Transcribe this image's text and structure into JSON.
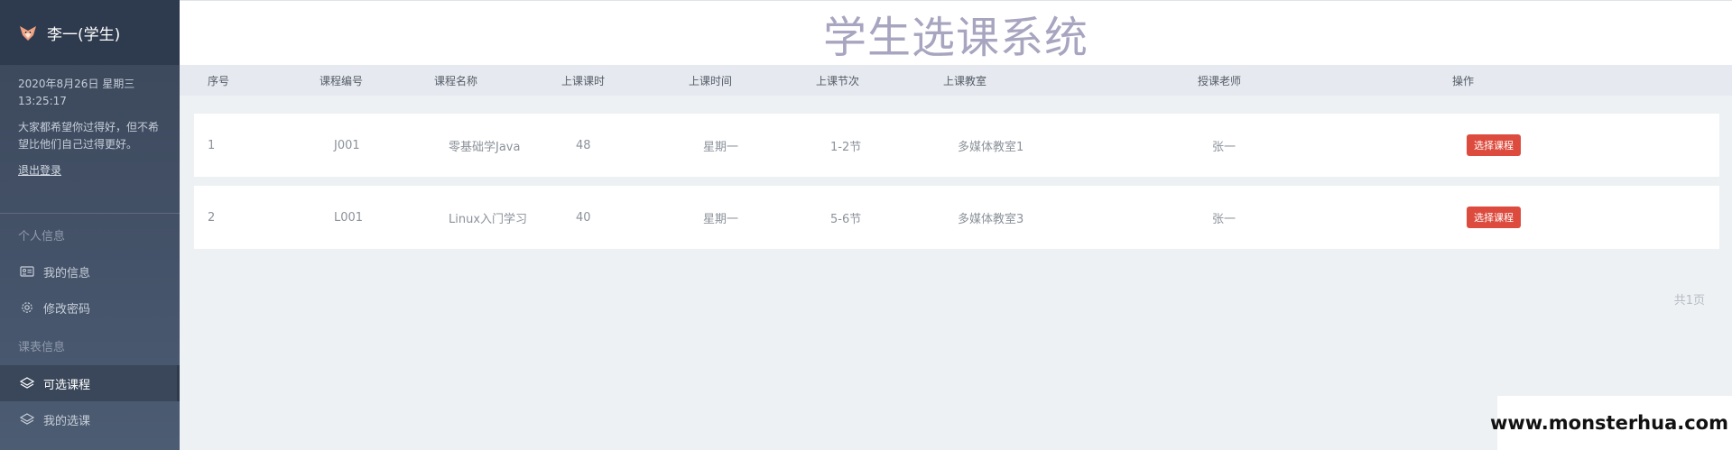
{
  "sidebar": {
    "user_label": "李一(学生)",
    "date_line": "2020年8月26日 星期三",
    "time_line": "13:25:17",
    "motto": "大家都希望你过得好，但不希望比他们自己过得更好。",
    "logout": "退出登录",
    "section_personal": "个人信息",
    "item_my_info": "我的信息",
    "item_change_password": "修改密码",
    "section_schedule": "课表信息",
    "item_available_courses": "可选课程",
    "item_my_courses": "我的选课"
  },
  "header": {
    "title": "学生选课系统"
  },
  "table": {
    "headers": [
      "序号",
      "课程编号",
      "课程名称",
      "上课课时",
      "上课时间",
      "上课节次",
      "上课教室",
      "授课老师",
      "操作"
    ],
    "rows": [
      {
        "no": "1",
        "code": "J001",
        "name": "零基础学Java",
        "hours": "48",
        "day": "星期一",
        "section": "1-2节",
        "room": "多媒体教室1",
        "teacher": "张一",
        "action": "选择课程"
      },
      {
        "no": "2",
        "code": "L001",
        "name": "Linux入门学习",
        "hours": "40",
        "day": "星期一",
        "section": "5-6节",
        "room": "多媒体教室3",
        "teacher": "张一",
        "action": "选择课程"
      }
    ]
  },
  "pager": {
    "text": "共1页"
  },
  "watermark": {
    "text": "www.monsterhua.com"
  },
  "colors": {
    "action_button": "#dc4b3e",
    "title": "#a7a5bf",
    "sidebar_bg": "#45536a"
  }
}
